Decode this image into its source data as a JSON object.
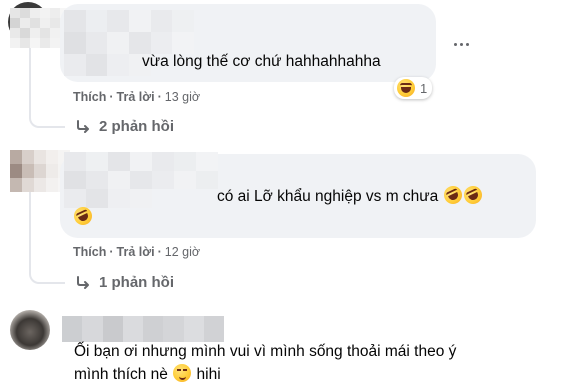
{
  "comments": [
    {
      "text": "vừa lòng thế cơ chứ hahhahhahha",
      "actions": {
        "like": "Thích",
        "separator": "·",
        "reply": "Trả lời",
        "time": "13 giờ"
      },
      "reaction_count": "1",
      "reaction_icon": "laughing-emoji",
      "replies_label": "2 phản hồi"
    },
    {
      "text": "có ai Lỡ khẩu nghiệp vs m chưa",
      "actions": {
        "like": "Thích",
        "separator": "·",
        "reply": "Trả lời",
        "time": "12 giờ"
      },
      "replies_label": "1 phản hồi"
    },
    {
      "text_line1": "Ối bạn ơi nhưng mình vui vì mình sống thoải mái theo ý",
      "text_line2_a": "mình thích nè",
      "text_line2_b": "hihi"
    }
  ],
  "colors": {
    "bubble": "#f0f2f5",
    "text": "#050505",
    "secondary": "#65676b",
    "thread_line": "#e4e6eb"
  }
}
